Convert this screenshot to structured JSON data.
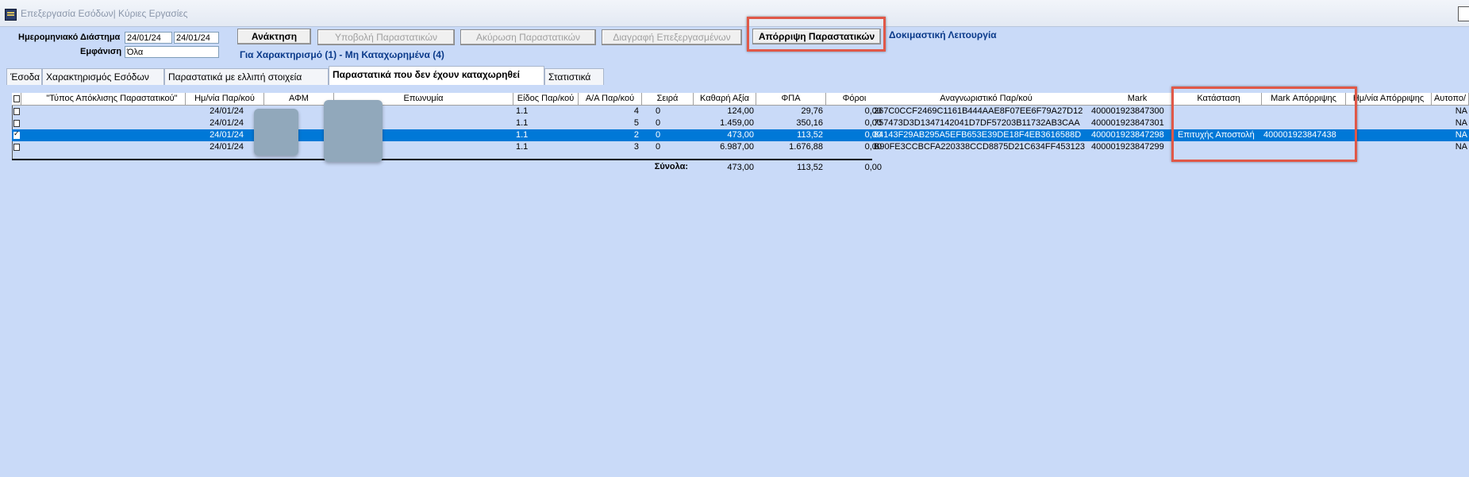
{
  "window": {
    "title": "Επεξεργασία Εσόδων| Κύριες Εργασίες"
  },
  "filters": {
    "date_range_label": "Ημερομηνιακό Διάστημα",
    "date_from": "24/01/24",
    "date_to": "24/01/24",
    "display_label": "Εμφάνιση",
    "display_value": "Όλα"
  },
  "toolbar": {
    "retrieve": "Ανάκτηση",
    "submit": "Υποβολή Παραστατικών",
    "cancel": "Ακύρωση Παραστατικών",
    "delete_processed": "Διαγραφή Επεξεργασμένων",
    "reject": "Απόρριψη Παραστατικών",
    "test_mode": "Δοκιμαστική Λειτουργία",
    "summary": "Για Χαρακτηρισμό (1) - Μη Καταχωρημένα (4)"
  },
  "tabs": [
    "Έσοδα",
    "Χαρακτηρισμός Εσόδων",
    "Παραστατικά με ελλιπή στοιχεία",
    "Παραστατικά που δεν έχουν καταχωρηθεί",
    "Στατιστικά"
  ],
  "grid": {
    "columns": [
      "\"Τύπος Απόκλισης Παραστατικού\"",
      "Ημ/νία Παρ/κού",
      "ΑΦΜ",
      "Επωνυμία",
      "Είδος Παρ/κού",
      "Α/Α Παρ/κού",
      "Σειρά",
      "Καθαρή Αξία",
      "ΦΠΑ",
      "Φόροι",
      "Αναγνωριστικό Παρ/κού",
      "Mark",
      "Κατάσταση",
      "Mark Απόρριψης",
      "Ημ/νία Απόρριψης",
      "Αυτοπο/"
    ],
    "rows": [
      {
        "date": "24/01/24",
        "type": "1.1",
        "aa": "4",
        "series": "0",
        "net": "124,00",
        "vat": "29,76",
        "taxes": "0,00",
        "uid": "267C0CCF2469C1161B444AAE8F07EE6F79A27D12",
        "mark": "400001923847300",
        "status": "",
        "reject_mark": "",
        "auto": "NA"
      },
      {
        "date": "24/01/24",
        "type": "1.1",
        "aa": "5",
        "series": "0",
        "net": "1.459,00",
        "vat": "350,16",
        "taxes": "0,00",
        "uid": "757473D3D1347142041D7DF57203B11732AB3CAA",
        "mark": "400001923847301",
        "status": "",
        "reject_mark": "",
        "auto": "NA"
      },
      {
        "date": "24/01/24",
        "type": "1.1",
        "aa": "2",
        "series": "0",
        "net": "473,00",
        "vat": "113,52",
        "taxes": "0,00",
        "uid": "84143F29AB295A5EFB653E39DE18F4EB3616588D",
        "mark": "400001923847298",
        "status": "Επιτυχής Αποστολή",
        "reject_mark": "400001923847438",
        "auto": "NA",
        "selected": true
      },
      {
        "date": "24/01/24",
        "type": "1.1",
        "aa": "3",
        "series": "0",
        "net": "6.987,00",
        "vat": "1.676,88",
        "taxes": "0,00",
        "uid": "B90FE3CCBCFA220338CCD8875D21C634FF453123",
        "mark": "400001923847299",
        "status": "",
        "reject_mark": "",
        "auto": "NA"
      }
    ],
    "totals": {
      "label": "Σύνολα:",
      "net": "473,00",
      "vat": "113,52",
      "taxes": "0,00"
    }
  },
  "colors": {
    "background": "#c9daf8",
    "selection": "#0078d7",
    "highlight": "#e05848",
    "accent_text": "#0a3a8a"
  }
}
